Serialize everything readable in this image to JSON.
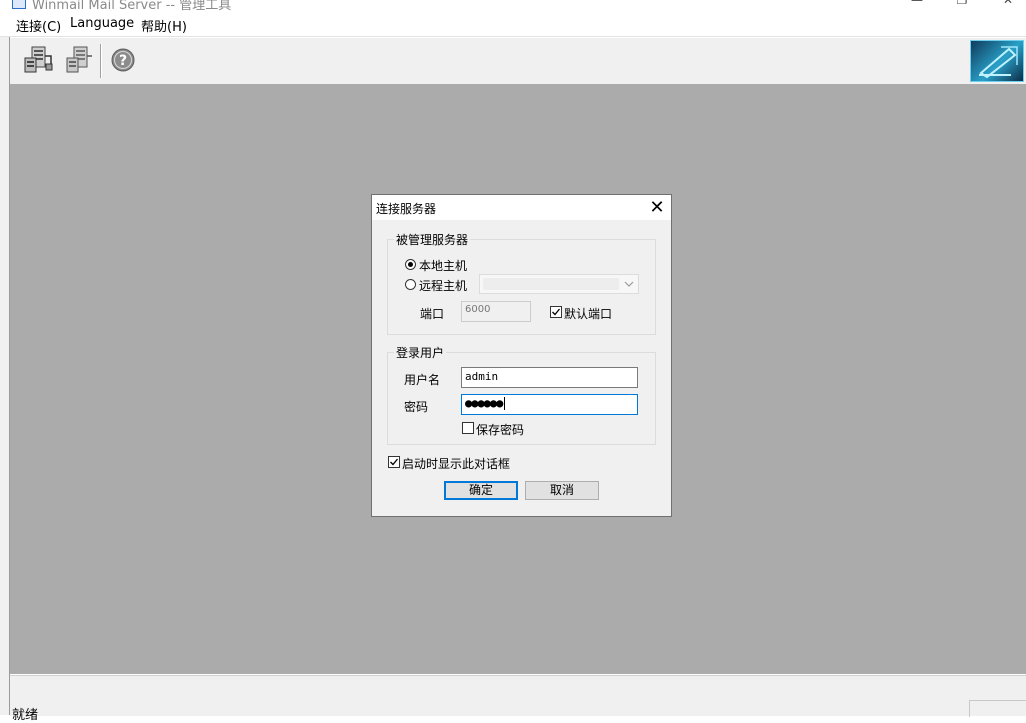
{
  "window": {
    "title": "Winmail Mail Server -- 管理工具",
    "minimize_glyph": "—",
    "restore_glyph": "❐",
    "close_glyph": "✕"
  },
  "menu": [
    {
      "label": "连接(C)"
    },
    {
      "label": "Language"
    },
    {
      "label": "帮助(H)"
    }
  ],
  "toolbar": {
    "buttons": [
      {
        "icon": "connect-server-icon"
      },
      {
        "icon": "disconnect-server-icon"
      },
      {
        "icon": "help-icon"
      }
    ],
    "brand_icon": "winmail-logo-icon"
  },
  "statusbar": {
    "text": "就绪"
  },
  "dialog": {
    "title": "连接服务器",
    "close_glyph": "✕",
    "server_group": {
      "label": "被管理服务器",
      "local_host_label": "本地主机",
      "local_host_selected": true,
      "remote_host_label": "远程主机",
      "remote_host_selected": false,
      "remote_host_value": "",
      "port_label": "端口",
      "port_value": "6000",
      "default_port_label": "默认端口",
      "default_port_checked": true
    },
    "login_group": {
      "label": "登录用户",
      "username_label": "用户名",
      "username_value": "admin",
      "password_label": "密码",
      "password_masked": "●●●●●●",
      "save_password_label": "保存密码",
      "save_password_checked": false
    },
    "show_on_startup_label": "启动时显示此对话框",
    "show_on_startup_checked": true,
    "ok_label": "确定",
    "cancel_label": "取消"
  }
}
